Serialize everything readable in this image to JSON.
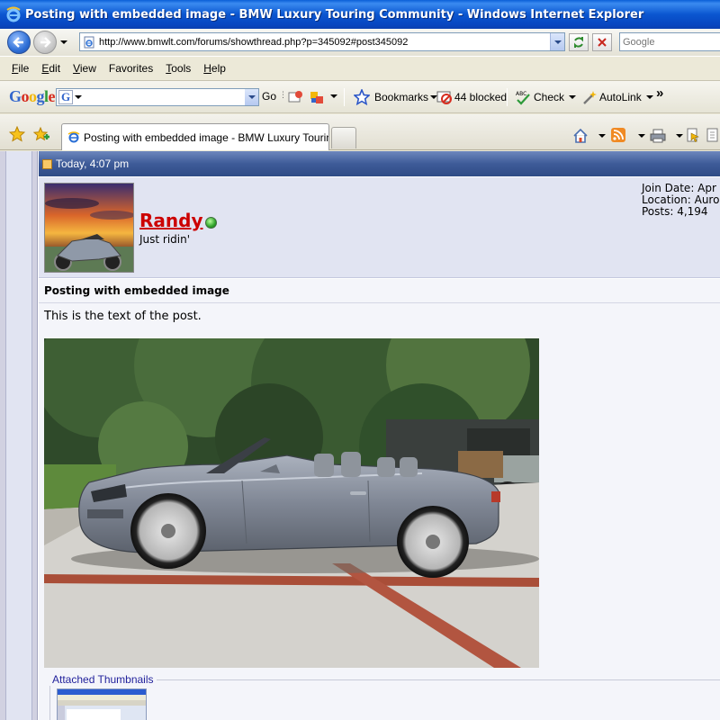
{
  "window": {
    "title": "Posting with embedded image - BMW Luxury Touring Community - Windows Internet Explorer"
  },
  "address": {
    "url": "http://www.bmwlt.com/forums/showthread.php?p=345092#post345092",
    "search_placeholder": "Google"
  },
  "menu": {
    "items": [
      {
        "label": "File",
        "key": "F",
        "rest": "ile"
      },
      {
        "label": "Edit",
        "key": "E",
        "rest": "dit"
      },
      {
        "label": "View",
        "key": "V",
        "rest": "iew"
      },
      {
        "label": "Favorites",
        "key": "",
        "rest": "Favorites"
      },
      {
        "label": "Tools",
        "key": "T",
        "rest": "ools"
      },
      {
        "label": "Help",
        "key": "H",
        "rest": "elp"
      }
    ]
  },
  "google_toolbar": {
    "logo": "Google",
    "go_label": "Go",
    "bookmarks_label": "Bookmarks",
    "blocked_label": "44 blocked",
    "check_label": "Check",
    "autolink_label": "AutoLink",
    "more_label": "»"
  },
  "tabs": {
    "active_title": "Posting with embedded image - BMW Luxury Touring ..."
  },
  "post": {
    "timestamp": "Today, 4:07 pm",
    "username": "Randy",
    "user_title": "Just ridin'",
    "join_date": "Join Date: Apr",
    "location": "Location: Auror",
    "posts": "Posts: 4,194",
    "title": "Posting with embedded image",
    "text": "This is the text of the post.",
    "attachments_legend": "Attached Thumbnails"
  },
  "colors": {
    "title_bar": "#0a56d0",
    "post_header": "#3e5b98",
    "username": "#cc0000",
    "user_panel": "#e1e4f2"
  }
}
